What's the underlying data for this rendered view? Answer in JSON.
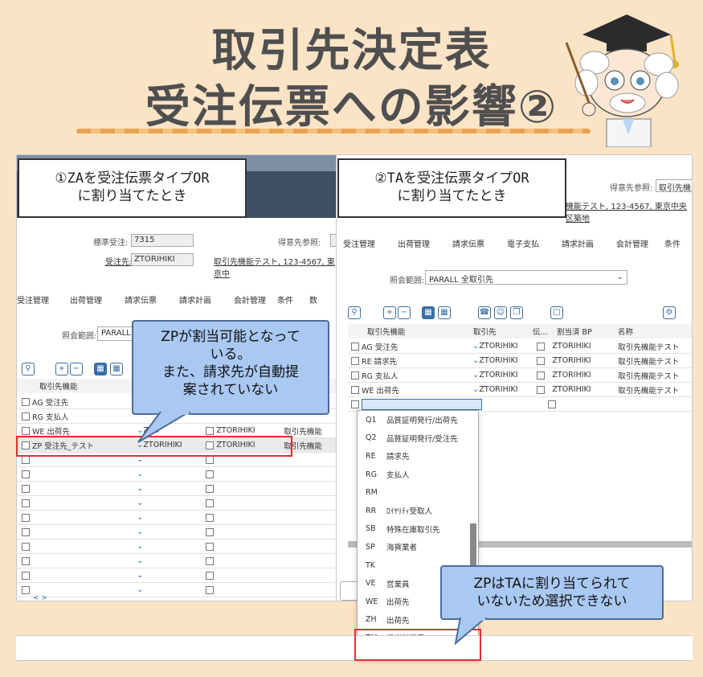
{
  "title_line1": "取引先決定表",
  "title_line2": "受注伝票への影響②",
  "callout_left": {
    "line1": "①ZAを受注伝票タイプOR",
    "line2": "に割り当てたとき"
  },
  "callout_right": {
    "line1": "②TAを受注伝票タイプOR",
    "line2": "に割り当てたとき"
  },
  "bubble_zp": {
    "line1": "ZPが割当可能となって",
    "line2": "いる。",
    "line3": "また、請求先が自動提",
    "line4": "案されていない"
  },
  "bubble_ta": {
    "line1": "ZPはTAに割り当てられて",
    "line2": "いないため選択できない"
  },
  "left": {
    "std_label": "標準受注:",
    "std_value": "7315",
    "sold_label": "受注先:",
    "sold_value": "ZTORIHIKI",
    "sold_desc": "取引先機能テスト, 123-4567, 東京中",
    "ref_label": "得意先参照:",
    "tabs": [
      "受注管理",
      "出荷管理",
      "請求伝票",
      "請求計画",
      "会計管理",
      "条件",
      "数"
    ],
    "scope_label": "照会範囲:",
    "scope_value": "PARALL",
    "col_function": "取引先機能",
    "rows": [
      {
        "fn": "AG 受注先",
        "partner": "",
        "name": "",
        "desc": ""
      },
      {
        "fn": "RG 支払人",
        "partner": "",
        "name": "",
        "desc": ""
      },
      {
        "fn": "WE 出荷先",
        "partner": "ZTO",
        "name": "ZTORIHIKI",
        "desc": "取引先機能"
      },
      {
        "fn": "ZP 受注先_テスト",
        "partner": "ZTORIHIKI",
        "name": "ZTORIHIKI",
        "desc": "取引先機能"
      }
    ]
  },
  "right": {
    "ref_label": "得意先参照:",
    "ref_value": "取引先機",
    "addr": "機能テスト, 123-4567, 東京中央区築地",
    "tabs": [
      "受注管理",
      "出荷管理",
      "請求伝票",
      "電子支払",
      "請求計画",
      "会計管理",
      "条件"
    ],
    "scope_label": "照会範囲:",
    "scope_value": "PARALL 全取引先",
    "cols": {
      "function": "取引先機能",
      "partner": "取引先",
      "den": "伝...",
      "assigned": "割当済 BP",
      "name": "名称"
    },
    "rows": [
      {
        "fn": "AG 受注先",
        "partner": "ZTORIHIKI",
        "bp": "ZTORIHIKI",
        "name": "取引先機能テスト"
      },
      {
        "fn": "RE 請求先",
        "partner": "ZTORIHIKI",
        "bp": "ZTORIHIKI",
        "name": "取引先機能テスト"
      },
      {
        "fn": "RG 支払人",
        "partner": "ZTORIHIKI",
        "bp": "ZTORIHIKI",
        "name": "取引先機能テスト"
      },
      {
        "fn": "WE 出荷先",
        "partner": "ZTORIHIKI",
        "bp": "ZTORIHIKI",
        "name": "取引先機能テスト"
      }
    ],
    "dropdown": [
      {
        "code": "Q1",
        "label": "品質証明発行/出荷先"
      },
      {
        "code": "Q2",
        "label": "品質証明発行/受注先"
      },
      {
        "code": "RE",
        "label": "請求先"
      },
      {
        "code": "RG",
        "label": "支払人"
      },
      {
        "code": "RM",
        "label": ""
      },
      {
        "code": "RR",
        "label": "ﾛｲﾔﾘﾃｨ受取人"
      },
      {
        "code": "SB",
        "label": "特殊在庫取引先"
      },
      {
        "code": "SP",
        "label": "海貨業者"
      },
      {
        "code": "TK",
        "label": ""
      },
      {
        "code": "VE",
        "label": "営業員"
      },
      {
        "code": "WE",
        "label": "出荷先"
      },
      {
        "code": "ZH",
        "label": "出荷先"
      },
      {
        "code": "ZM",
        "label": "担当従業員"
      }
    ]
  }
}
